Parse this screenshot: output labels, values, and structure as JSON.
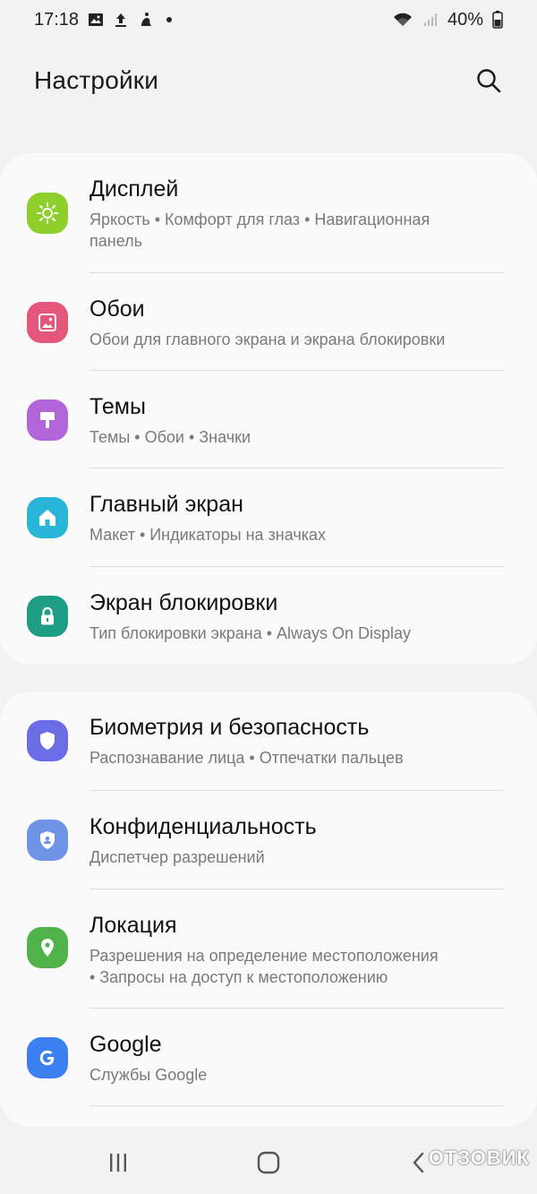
{
  "status_bar": {
    "time": "17:18",
    "battery": "40%",
    "left_icons": [
      "gallery-icon",
      "upload-icon",
      "accessibility-icon",
      "dot"
    ],
    "right_icons": [
      "wifi-icon",
      "signal-icon",
      "battery-icon"
    ]
  },
  "header": {
    "title": "Настройки",
    "search_icon": "search-icon"
  },
  "groups": [
    {
      "items": [
        {
          "title": "Дисплей",
          "subtitle_lines": [
            "Яркость  •  Комфорт для глаз  •  Навигационная",
            "панель"
          ],
          "icon": "display-icon",
          "color": "#8fcf2c"
        },
        {
          "title": "Обои",
          "subtitle_lines": [
            "Обои для главного экрана и экрана блокировки"
          ],
          "icon": "wallpaper-icon",
          "color": "#e5577a"
        },
        {
          "title": "Темы",
          "subtitle_lines": [
            "Темы  •  Обои  •  Значки"
          ],
          "icon": "themes-icon",
          "color": "#b265d8"
        },
        {
          "title": "Главный экран",
          "subtitle_lines": [
            "Макет  •  Индикаторы на значках"
          ],
          "icon": "home-screen-icon",
          "color": "#28b5d8"
        },
        {
          "title": "Экран блокировки",
          "subtitle_lines": [
            "Тип блокировки экрана  •  Always On Display"
          ],
          "icon": "lock-icon",
          "color": "#1f9e86"
        }
      ]
    },
    {
      "items": [
        {
          "title": "Биометрия и безопасность",
          "subtitle_lines": [
            "Распознавание лица  •  Отпечатки пальцев"
          ],
          "icon": "shield-icon",
          "color": "#6b6de6"
        },
        {
          "title": "Конфиденциальность",
          "subtitle_lines": [
            "Диспетчер разрешений"
          ],
          "icon": "privacy-icon",
          "color": "#6f93e6"
        },
        {
          "title": "Локация",
          "subtitle_lines": [
            "Разрешения на определение местоположения",
            "•  Запросы на доступ к местоположению"
          ],
          "icon": "location-icon",
          "color": "#4fb34a"
        },
        {
          "title": "Google",
          "subtitle_lines": [
            "Службы Google"
          ],
          "icon": "google-icon",
          "color": "#3b7ff0"
        }
      ]
    }
  ],
  "nav_bar": {
    "buttons": [
      "recents-icon",
      "home-icon",
      "back-icon"
    ]
  },
  "watermark": "ОТЗОВИК"
}
